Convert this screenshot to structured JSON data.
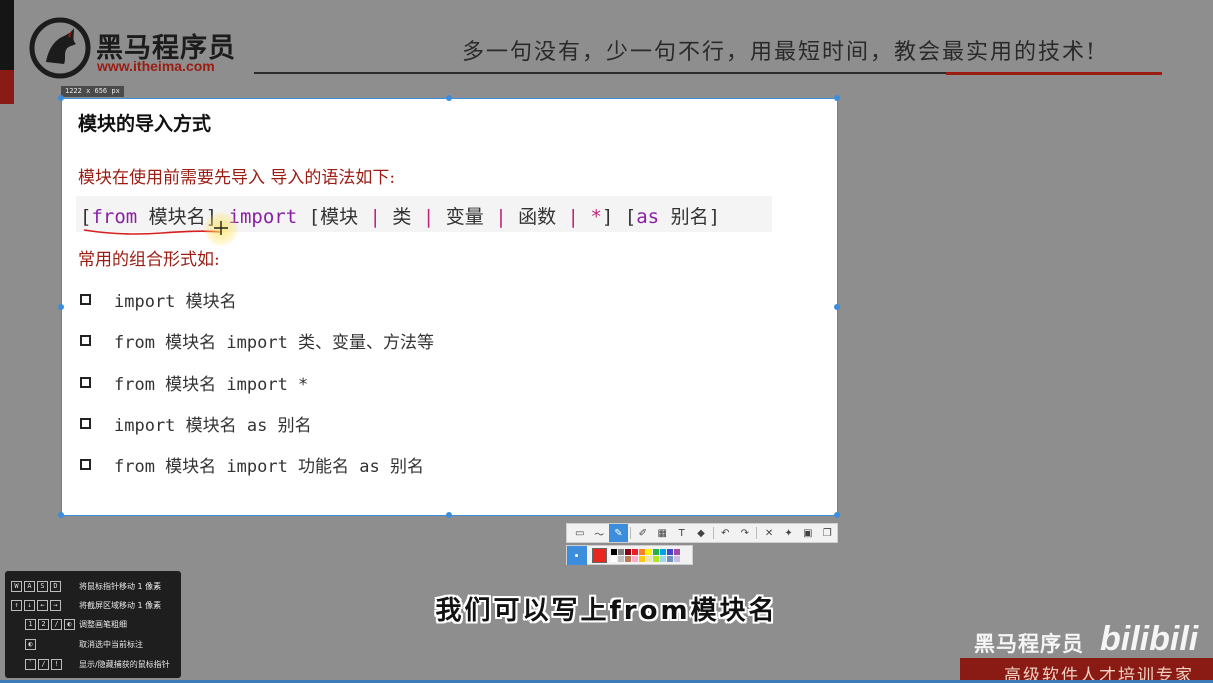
{
  "header": {
    "logo_cn": "黑马程序员",
    "logo_url": "www.itheima.com",
    "slogan": "多一句没有，少一句不行，用最短时间，教会最实用的技术!"
  },
  "capture": {
    "size_label": "1222 x 656  px"
  },
  "slide": {
    "title": "模块的导入方式",
    "intro": "模块在使用前需要先导入 导入的语法如下:",
    "syntax": {
      "p1": "[",
      "from": "from",
      "p2": " 模块名] ",
      "import": "import",
      "p3": " [模块 ",
      "bar1": "|",
      "p4": " 类 ",
      "bar2": "|",
      "p5": " 变量 ",
      "bar3": "|",
      "p6": " 函数 ",
      "bar4": "|",
      "p7": " ",
      "star": "*",
      "p8": "] [",
      "as": "as",
      "p9": " 别名]"
    },
    "combos_title": "常用的组合形式如:",
    "items": [
      "import 模块名",
      "from 模块名 import 类、变量、方法等",
      "from 模块名 import *",
      "import 模块名 as 别名",
      "from 模块名 import 功能名 as 别名"
    ]
  },
  "toolbar": {
    "icons": [
      "rectangle-icon",
      "line-icon",
      "pen-icon",
      "marker-icon",
      "mosaic-icon",
      "text-icon",
      "eraser-icon",
      "undo-icon",
      "redo-icon",
      "cancel-icon",
      "pin-icon",
      "save-icon",
      "copy-icon"
    ],
    "active_tool": "pen-icon",
    "current_color": "#e8281e",
    "swatches": [
      "#000000",
      "#7f7f7f",
      "#880015",
      "#ed1c24",
      "#ff7f27",
      "#fff200",
      "#22b14c",
      "#00a2e8",
      "#3f48cc",
      "#a349a4",
      "#ffffff",
      "#c3c3c3",
      "#b97a57",
      "#ffaec9",
      "#ffc90e",
      "#efe4b0",
      "#b5e61d",
      "#99d9ea",
      "#7092be",
      "#c8bfe7"
    ]
  },
  "help_panel": {
    "rows": [
      {
        "keys": [
          "W",
          "A",
          "S",
          "D"
        ],
        "text": "将鼠标指针移动 1 像素"
      },
      {
        "keys": [
          "↑",
          "↓",
          "←",
          "→"
        ],
        "text": "将截屏区域移动 1 像素"
      },
      {
        "keys": [
          "1",
          "2",
          "/",
          "◐"
        ],
        "text": "调整画笔粗细"
      },
      {
        "keys": [
          "◐"
        ],
        "text": "取消选中当前标注"
      },
      {
        "keys": [
          "`",
          "/",
          "!"
        ],
        "text": "显示/隐藏捕获的鼠标指针"
      }
    ]
  },
  "subtitle": "我们可以写上from模块名",
  "watermark": {
    "brand": "黑马程序员",
    "platform": "bilibili",
    "tagline": "高级软件人才培训专家"
  },
  "colors": {
    "accent_red": "#9b1c13",
    "keyword_purple": "#8a1fa5",
    "selection_blue": "#3c8ddc"
  }
}
